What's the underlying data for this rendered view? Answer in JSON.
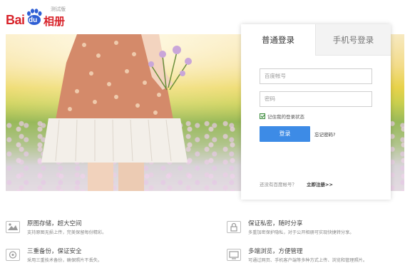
{
  "header": {
    "logo_bai": "Bai",
    "logo_du": "du",
    "logo_album": "相册",
    "logo_badge": "测试版"
  },
  "login": {
    "tabs": [
      {
        "label": "普通登录",
        "active": true
      },
      {
        "label": "手机号登录",
        "active": false
      }
    ],
    "account_placeholder": "百度帐号",
    "password_placeholder": "密码",
    "remember_label": "记住我的登录状态",
    "remember_checked": true,
    "login_button": "登录",
    "forgot_link": "忘记密码?",
    "no_account_text": "还没有百度帐号？",
    "register_link": "立即注册>>"
  },
  "features": [
    {
      "icon": "photo-icon",
      "title": "原图存储，超大空间",
      "desc": "支持原图无损上传，完美保留每份精彩。"
    },
    {
      "icon": "lock-icon",
      "title": "保证私密，随时分享",
      "desc": "多重加密保护隐私，对于公开相册可实现快捷转分享。"
    },
    {
      "icon": "backup-icon",
      "title": "三重备份，保证安全",
      "desc": "采用三重技术备份，确保照片不丢失。"
    },
    {
      "icon": "monitor-icon",
      "title": "多端浏览，方便管理",
      "desc": "可通过网页、手机客户端等多种方式上传、浏览和管理照片。"
    }
  ],
  "colors": {
    "brand_red": "#d8232a",
    "brand_blue": "#2f5fd4",
    "login_button": "#3d8be6"
  }
}
